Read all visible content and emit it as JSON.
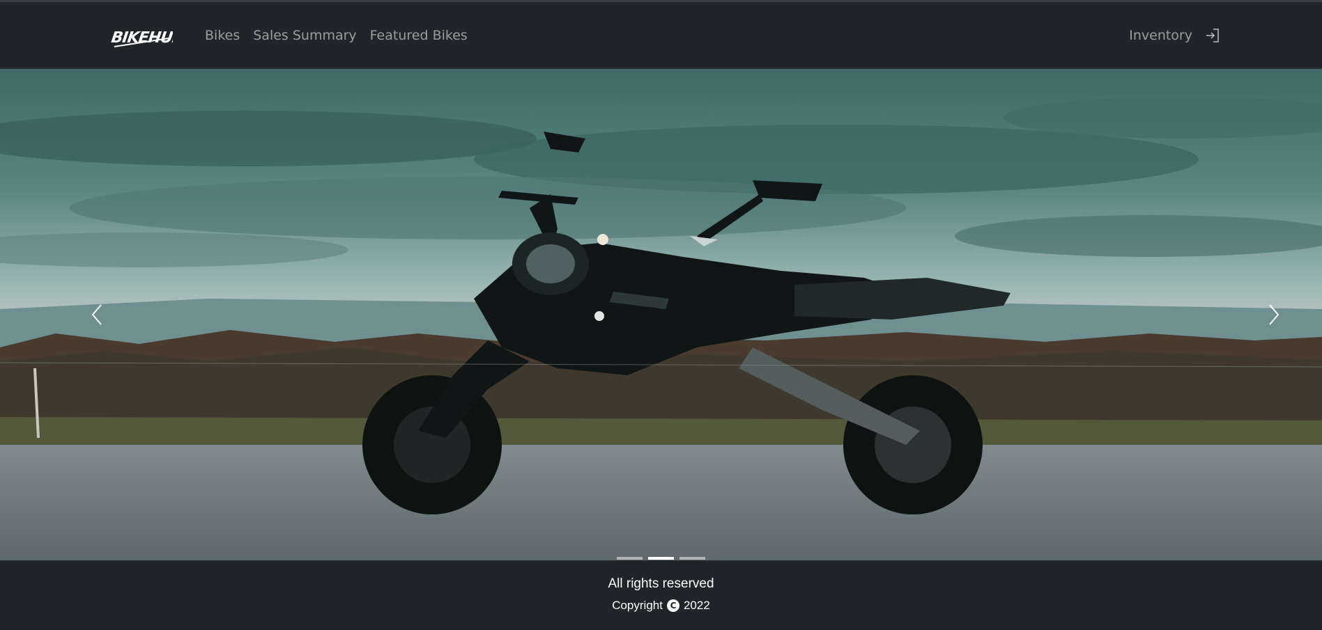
{
  "navbar": {
    "brand_logo_text": "BIKEHUB",
    "links": [
      {
        "label": "Bikes"
      },
      {
        "label": "Sales Summary"
      },
      {
        "label": "Featured Bikes"
      }
    ],
    "right_link": {
      "label": "Inventory"
    },
    "login_icon": "login-icon"
  },
  "carousel": {
    "slide_count": 3,
    "active_index": 1,
    "prev_icon": "chevron-left-icon",
    "next_icon": "chevron-right-icon"
  },
  "footer": {
    "line1": "All rights reserved",
    "copyright_label": "Copyright",
    "copyright_symbol": "C",
    "year": "2022"
  },
  "colors": {
    "navbar_bg": "#212529",
    "nav_link": "rgba(255,255,255,0.55)",
    "footer_text": "#ffffff"
  }
}
